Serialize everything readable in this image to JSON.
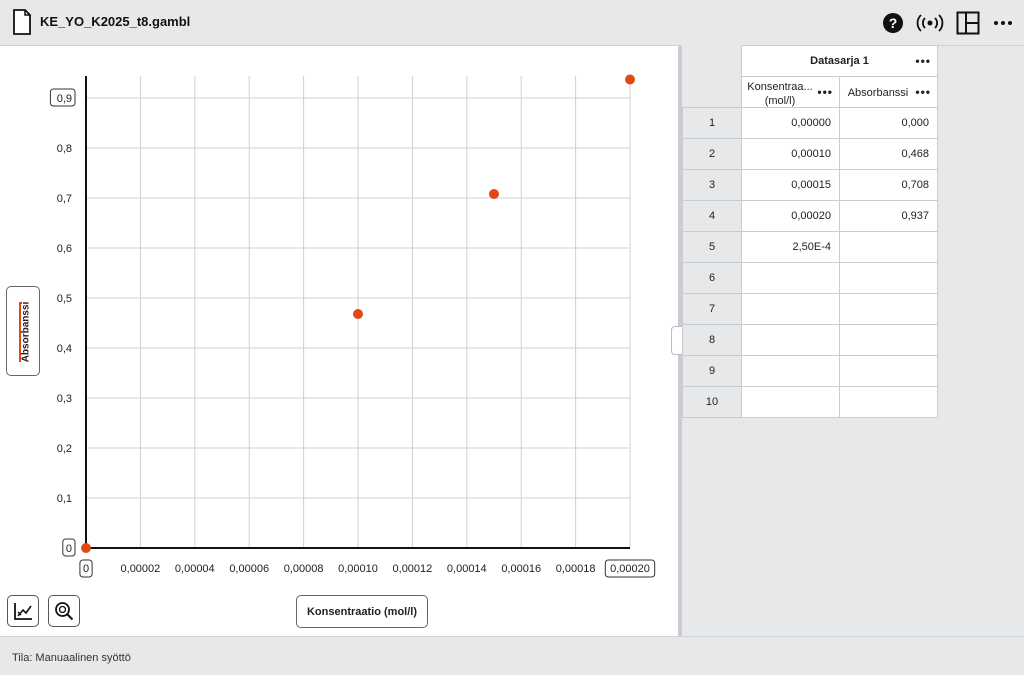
{
  "app": {
    "file_name": "KE_YO_K2025_t8.gambl",
    "icons": [
      "help-icon",
      "wireless-sensor-icon",
      "layout-icon",
      "more-options-icon"
    ]
  },
  "graph": {
    "x_axis_label": "Konsentraatio (mol/l)",
    "y_axis_label": "Absorbanssi",
    "y_min_label": "0",
    "y_max_label": "0,9",
    "x_min_label": "0",
    "x_max_label": "0,00020",
    "point_color": "#e04a12",
    "tools": [
      "graph-tools-icon",
      "zoom-icon"
    ]
  },
  "chart_data": {
    "type": "scatter",
    "x_label": "Konsentraatio (mol/l)",
    "y_label": "Absorbanssi",
    "xlim": [
      0,
      0.0002
    ],
    "ylim": [
      0,
      0.9
    ],
    "grid": true,
    "x_ticks": [
      "0",
      "0,00002",
      "0,00004",
      "0,00006",
      "0,00008",
      "0,00010",
      "0,00012",
      "0,00014",
      "0,00016",
      "0,00018",
      "0,00020"
    ],
    "y_ticks": [
      "0",
      "0,1",
      "0,2",
      "0,3",
      "0,4",
      "0,5",
      "0,6",
      "0,7",
      "0,8",
      "0,9"
    ],
    "points": [
      {
        "x": 0.0,
        "y": 0.0
      },
      {
        "x": 0.0001,
        "y": 0.468
      },
      {
        "x": 0.00015,
        "y": 0.708
      },
      {
        "x": 0.0002,
        "y": 0.937
      }
    ]
  },
  "table": {
    "series_name": "Datasarja 1",
    "columns": [
      "Konsentraa... (mol/l)",
      "Absorbanssi"
    ],
    "rows": [
      {
        "n": "1",
        "c1": "0,00000",
        "c2": "0,000"
      },
      {
        "n": "2",
        "c1": "0,00010",
        "c2": "0,468"
      },
      {
        "n": "3",
        "c1": "0,00015",
        "c2": "0,708"
      },
      {
        "n": "4",
        "c1": "0,00020",
        "c2": "0,937"
      },
      {
        "n": "5",
        "c1": "2,50E-4",
        "c2": ""
      },
      {
        "n": "6",
        "c1": "",
        "c2": ""
      },
      {
        "n": "7",
        "c1": "",
        "c2": ""
      },
      {
        "n": "8",
        "c1": "",
        "c2": ""
      },
      {
        "n": "9",
        "c1": "",
        "c2": ""
      },
      {
        "n": "10",
        "c1": "",
        "c2": ""
      }
    ],
    "more_label": "•••"
  },
  "status": {
    "text": "Tila: Manuaalinen syöttö"
  }
}
